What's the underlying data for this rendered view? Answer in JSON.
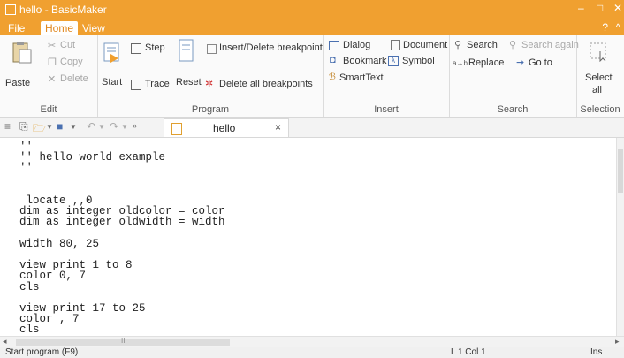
{
  "window": {
    "title": "hello - BasicMaker",
    "minimize": "–",
    "maximize": "□",
    "close": "✕"
  },
  "tabs": [
    {
      "label": "File"
    },
    {
      "label": "Home"
    },
    {
      "label": "View"
    }
  ],
  "help": "?",
  "collapse": "^",
  "ribbon": {
    "edit": {
      "paste": "Paste",
      "cut": "Cut",
      "copy": "Copy",
      "delete": "Delete",
      "label": "Edit"
    },
    "program": {
      "start": "Start",
      "step": "Step",
      "trace": "Trace",
      "reset": "Reset",
      "insert_delete_breakpoint": "Insert/Delete breakpoint",
      "delete_all_breakpoints": "Delete all breakpoints",
      "label": "Program"
    },
    "insert": {
      "dialog": "Dialog",
      "document": "Document",
      "bookmark": "Bookmark",
      "symbol": "Symbol",
      "smarttext": "SmartText",
      "label": "Insert"
    },
    "search": {
      "search": "Search",
      "search_again": "Search again",
      "replace": "Replace",
      "goto": "Go to",
      "label": "Search"
    },
    "selection": {
      "select_all_1": "Select",
      "select_all_2": "all",
      "label": "Selection"
    }
  },
  "document_tab": {
    "name": "hello",
    "close": "×"
  },
  "code": "'' \n'' hello world example\n''\n\n\n locate ,,0\ndim as integer oldcolor = color\ndim as integer oldwidth = width\n\nwidth 80, 25\n\nview print 1 to 8\ncolor 0, 7\ncls\n\nview print 17 to 25\ncolor , 7\ncls",
  "scrollbar": {
    "h_grip": "III"
  },
  "status": {
    "message": "Start program (F9)",
    "position": "L 1 Col 1",
    "mode": "Ins"
  },
  "colors": {
    "accent": "#f0a030",
    "tab_active_text": "#e08820",
    "ribbon_bg": "#fafafa"
  }
}
